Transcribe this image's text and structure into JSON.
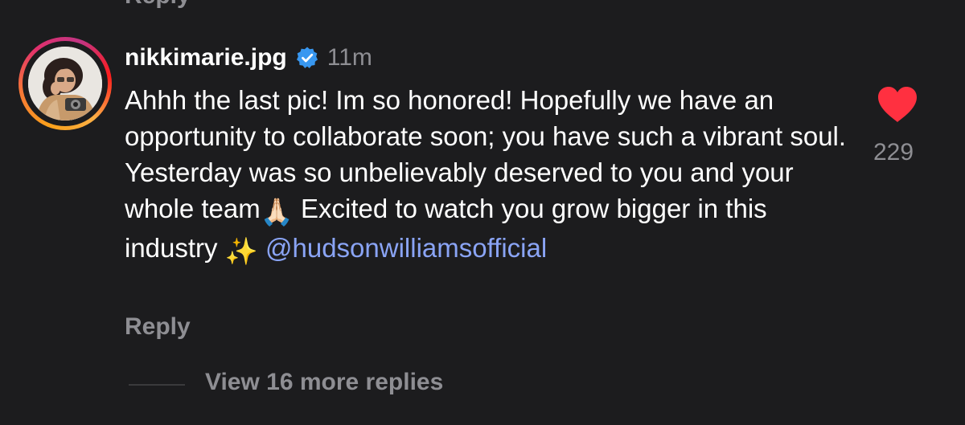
{
  "previous": {
    "reply_label": "Reply"
  },
  "comment": {
    "username": "nikkimarie.jpg",
    "verified_icon": "verified-badge-icon",
    "time": "11m",
    "text_part1": "Ahhh the last pic! Im so honored! Hopefully we have an opportunity to collaborate soon; you have such a vibrant soul. Yesterday was so unbelievably deserved to you and your whole team",
    "emoji_hands": "🙏🏻",
    "text_part2": " Excited to watch you grow bigger in this industry ",
    "emoji_sparkles": "✨",
    "mention": "@hudsonwilliamsofficial",
    "reply_label": "Reply",
    "like_icon": "heart-filled-icon",
    "like_count": "229",
    "like_color": "#ff3040",
    "mention_color": "#8aa4f5"
  },
  "replies": {
    "view_more_label": "View 16 more replies"
  }
}
